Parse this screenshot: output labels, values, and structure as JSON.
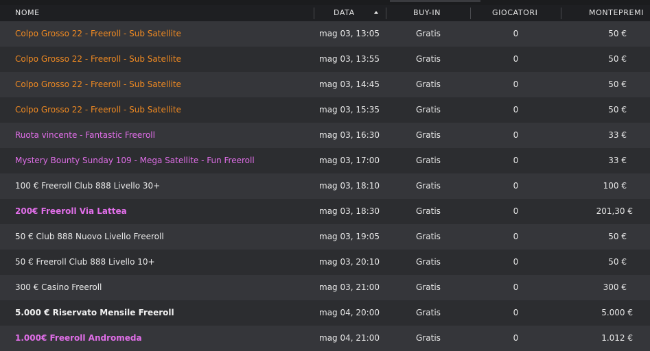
{
  "header": {
    "name": "NOME",
    "date": "DATA",
    "buyin": "BUY-IN",
    "players": "GIOCATORI",
    "prize": "MONTEPREMI"
  },
  "colors": {
    "orange": "#f08a22",
    "pink": "#e06ee8",
    "white": "#e8e8e8",
    "row_a": "#35363a",
    "row_b": "#2c2d30",
    "header_bg": "#1e1f22"
  },
  "rows": [
    {
      "name": "Colpo Grosso 22 - Freeroll - Sub Satellite",
      "date": "mag 03, 13:05",
      "buyin": "Gratis",
      "players": "0",
      "prize": "50 €"
    },
    {
      "name": "Colpo Grosso 22 - Freeroll - Sub Satellite",
      "date": "mag 03, 13:55",
      "buyin": "Gratis",
      "players": "0",
      "prize": "50 €"
    },
    {
      "name": "Colpo Grosso 22 - Freeroll - Sub Satellite",
      "date": "mag 03, 14:45",
      "buyin": "Gratis",
      "players": "0",
      "prize": "50 €"
    },
    {
      "name": "Colpo Grosso 22 - Freeroll - Sub Satellite",
      "date": "mag 03, 15:35",
      "buyin": "Gratis",
      "players": "0",
      "prize": "50 €"
    },
    {
      "name": "Ruota vincente - Fantastic Freeroll",
      "date": "mag 03, 16:30",
      "buyin": "Gratis",
      "players": "0",
      "prize": "33 €"
    },
    {
      "name": "Mystery Bounty Sunday 109 - Mega Satellite - Fun Freeroll",
      "date": "mag 03, 17:00",
      "buyin": "Gratis",
      "players": "0",
      "prize": "33 €"
    },
    {
      "name": "100 € Freeroll Club 888 Livello 30+",
      "date": "mag 03, 18:10",
      "buyin": "Gratis",
      "players": "0",
      "prize": "100 €"
    },
    {
      "name": "200€ Freeroll Via Lattea",
      "date": "mag 03, 18:30",
      "buyin": "Gratis",
      "players": "0",
      "prize": "201,30 €"
    },
    {
      "name": "50 € Club 888 Nuovo Livello Freeroll",
      "date": "mag 03, 19:05",
      "buyin": "Gratis",
      "players": "0",
      "prize": "50 €"
    },
    {
      "name": "50 € Freeroll Club 888 Livello 10+",
      "date": "mag 03, 20:10",
      "buyin": "Gratis",
      "players": "0",
      "prize": "50 €"
    },
    {
      "name": "300 € Casino Freeroll",
      "date": "mag 03, 21:00",
      "buyin": "Gratis",
      "players": "0",
      "prize": "300 €"
    },
    {
      "name": "5.000 € Riservato Mensile Freeroll",
      "date": "mag 04, 20:00",
      "buyin": "Gratis",
      "players": "0",
      "prize": "5.000 €"
    },
    {
      "name": "1.000€ Freeroll Andromeda",
      "date": "mag 04, 21:00",
      "buyin": "Gratis",
      "players": "0",
      "prize": "1.012 €"
    }
  ]
}
